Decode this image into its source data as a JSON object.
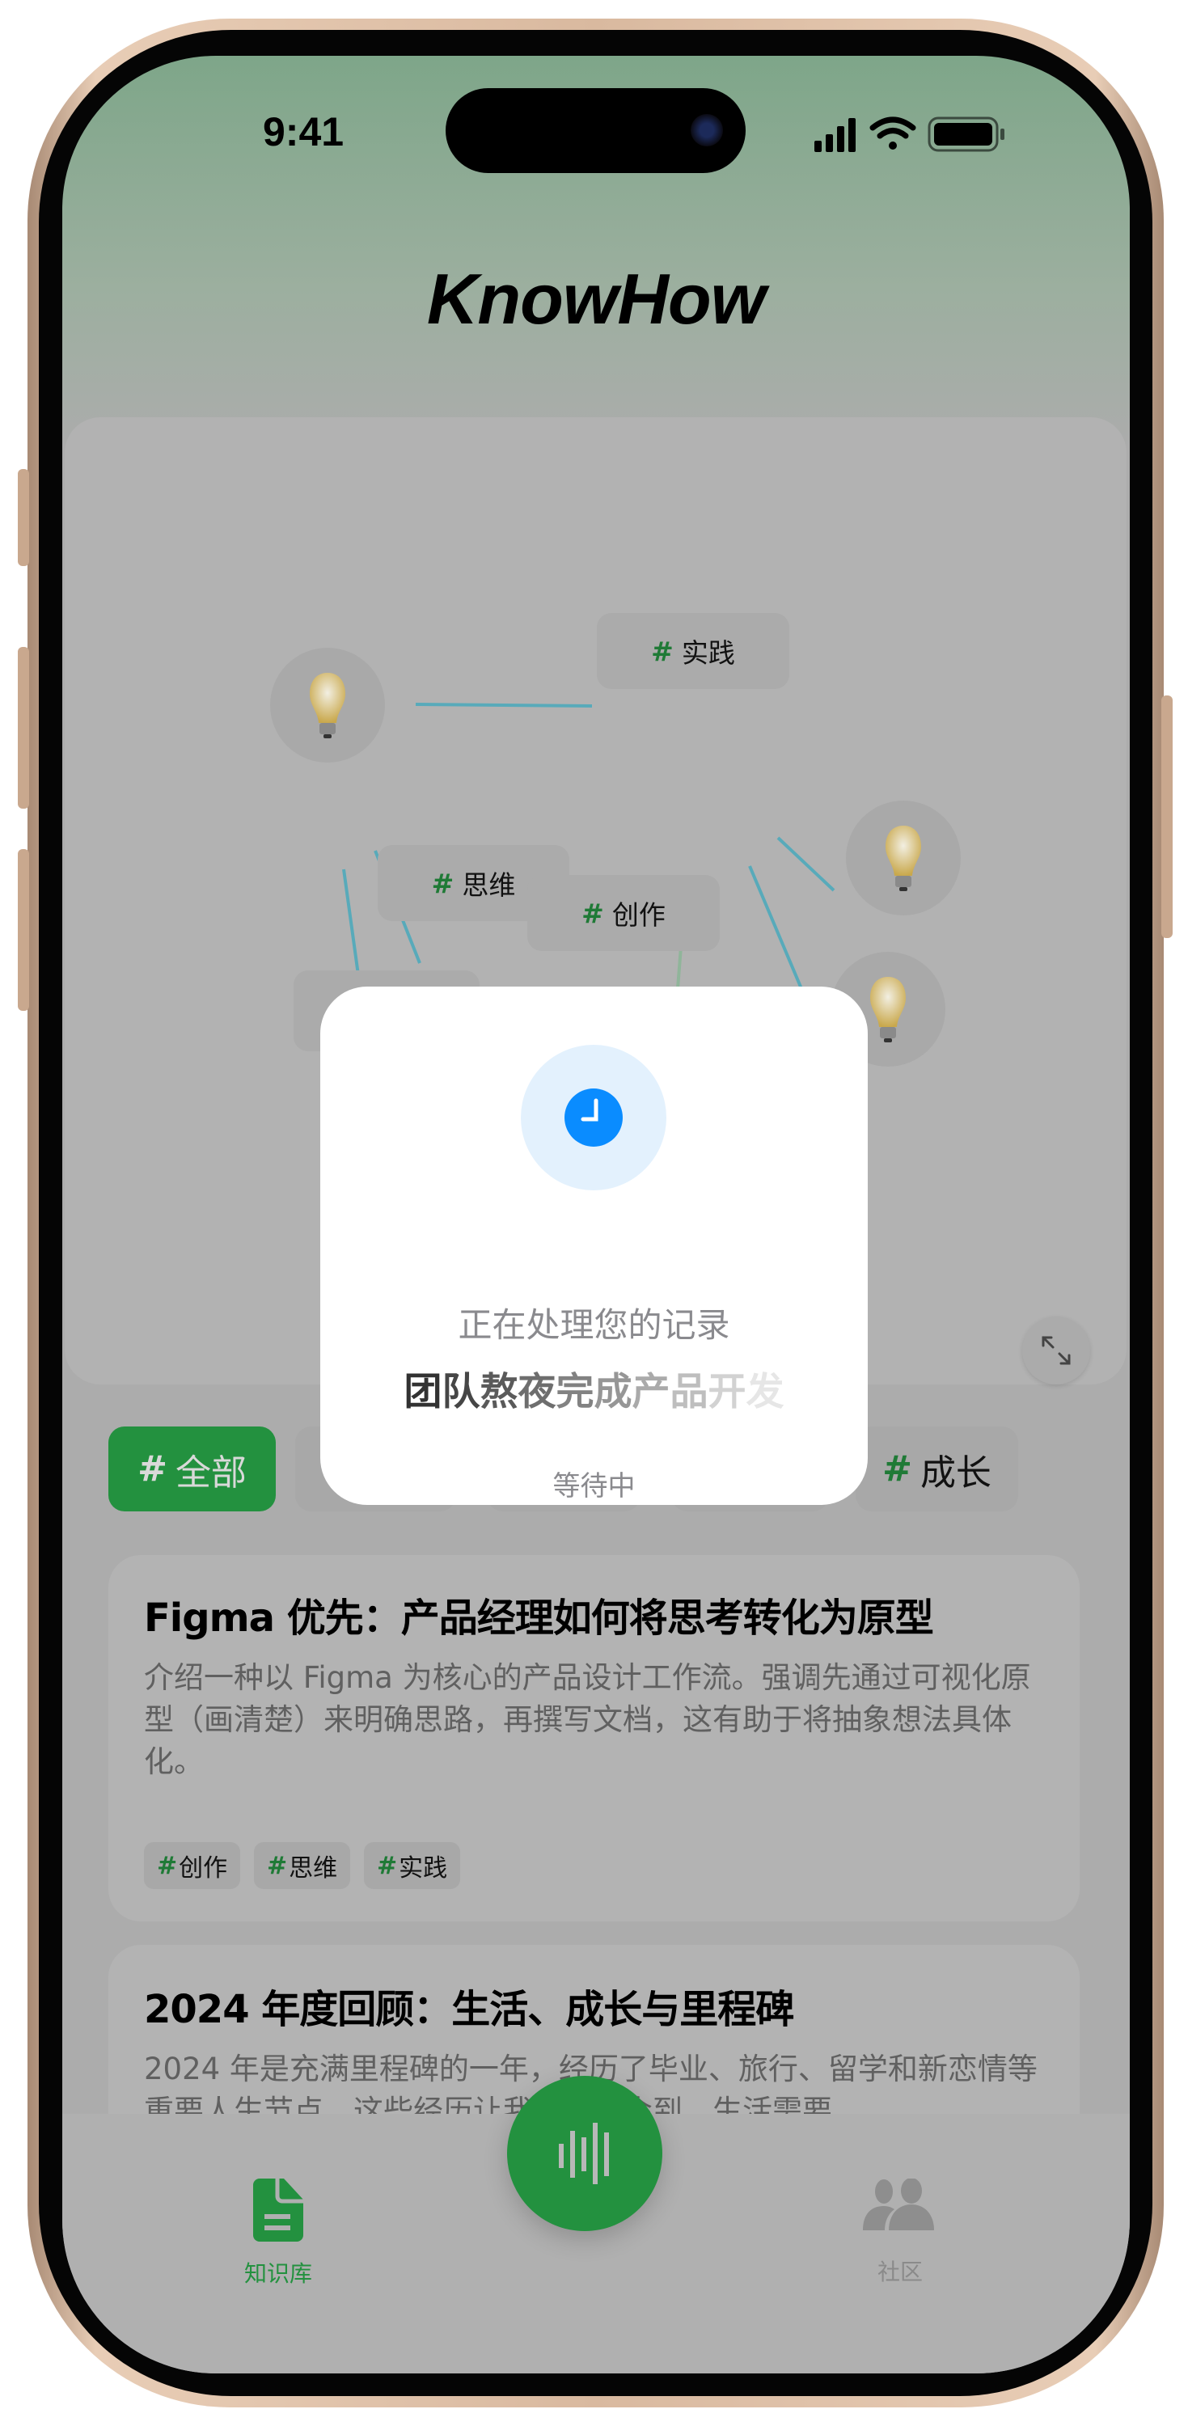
{
  "status_bar": {
    "time": "9:41"
  },
  "header": {
    "title": "KnowHow"
  },
  "graph": {
    "nodes": [
      {
        "type": "tag",
        "label": "实践"
      },
      {
        "type": "tag",
        "label": "思维"
      },
      {
        "type": "tag",
        "label": "创作"
      }
    ],
    "bulb_icon": "lightbulb-icon",
    "expand_icon": "expand-icon"
  },
  "filters": {
    "hash": "#",
    "chips": [
      {
        "label": "全部",
        "active": true
      },
      {
        "label": "成长",
        "active": false
      }
    ]
  },
  "cards": [
    {
      "title": "Figma 优先：产品经理如何将思考转化为原型",
      "description": "介绍一种以 Figma 为核心的产品设计工作流。强调先通过可视化原型（画清楚）来明确思路，再撰写文档，这有助于将抽象想法具体化。",
      "tags": [
        "创作",
        "思维",
        "实践"
      ]
    },
    {
      "title": "2024 年度回顾：生活、成长与里程碑",
      "description": "2024 年是充满里程碑的一年，经历了毕业、旅行、留学和新恋情等重要人生节点，这些经历让我深刻体会到，生活需要"
    }
  ],
  "tabbar": {
    "knowledge": {
      "label": "知识库",
      "icon": "document-icon"
    },
    "record": {
      "icon": "waveform-icon"
    },
    "community": {
      "label": "社区",
      "icon": "people-icon"
    }
  },
  "modal": {
    "icon": "clock-icon",
    "heading": "正在处理您的记录",
    "record_title_chars": [
      "团",
      "队",
      "熬",
      "夜",
      "完",
      "成",
      "产",
      "品",
      "开",
      "发"
    ],
    "status": "等待中"
  },
  "colors": {
    "accent": "#23913f",
    "clock": "#0a8cff",
    "clock_bg": "#e3f1fd"
  }
}
